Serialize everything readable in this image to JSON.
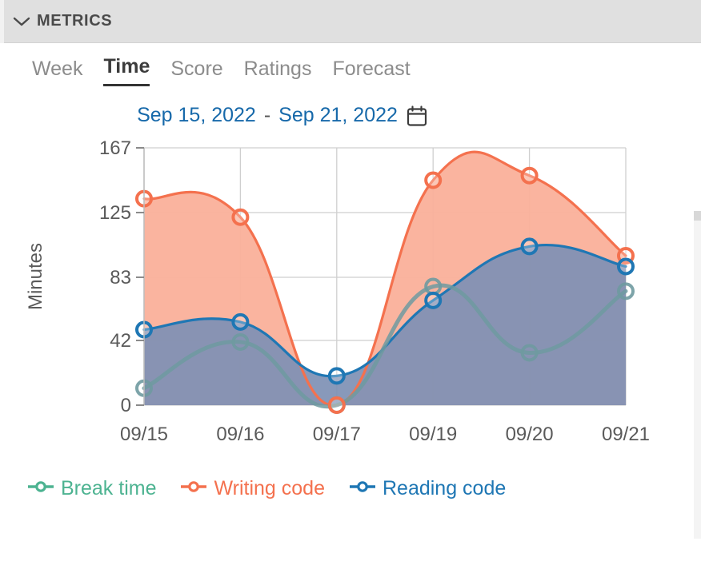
{
  "header": {
    "title": "METRICS",
    "collapse_icon": "chevron-down-icon"
  },
  "tabs": [
    {
      "label": "Week",
      "active": false
    },
    {
      "label": "Time",
      "active": true
    },
    {
      "label": "Score",
      "active": false
    },
    {
      "label": "Ratings",
      "active": false
    },
    {
      "label": "Forecast",
      "active": false
    }
  ],
  "date_range": {
    "start": "Sep 15, 2022",
    "separator": "-",
    "end": "Sep 21, 2022",
    "calendar_icon": "calendar-icon",
    "link_color": "#1769aa"
  },
  "colors": {
    "break_time": "#4db391",
    "writing_code": "#f4714e",
    "reading_code": "#1f77b4",
    "area_writing": "#fab09a",
    "area_reading": "#7e90b4",
    "grid": "#cfcfcf",
    "axis_text": "#5a5a5a",
    "header_bg": "#e0e0e0"
  },
  "legend": [
    {
      "label": "Break time",
      "color": "#4db391"
    },
    {
      "label": "Writing code",
      "color": "#f4714e"
    },
    {
      "label": "Reading code",
      "color": "#1f77b4"
    }
  ],
  "chart_data": {
    "type": "area",
    "title": "",
    "xlabel": "",
    "ylabel": "Minutes",
    "categories": [
      "09/15",
      "09/16",
      "09/17",
      "09/19",
      "09/20",
      "09/21"
    ],
    "yticks": [
      0,
      42,
      83,
      125,
      167
    ],
    "ylim": [
      0,
      167
    ],
    "grid": true,
    "legend_position": "bottom-left",
    "series": [
      {
        "name": "Writing code",
        "color": "#f4714e",
        "values": [
          134,
          122,
          0,
          146,
          149,
          97
        ]
      },
      {
        "name": "Reading code",
        "color": "#1f77b4",
        "values": [
          49,
          54,
          19,
          68,
          103,
          90
        ]
      },
      {
        "name": "Break time",
        "color": "#4db391",
        "values": [
          11,
          41,
          0,
          77,
          34,
          74
        ]
      }
    ]
  },
  "scrollbar": {
    "name": "vertical-scrollbar"
  }
}
